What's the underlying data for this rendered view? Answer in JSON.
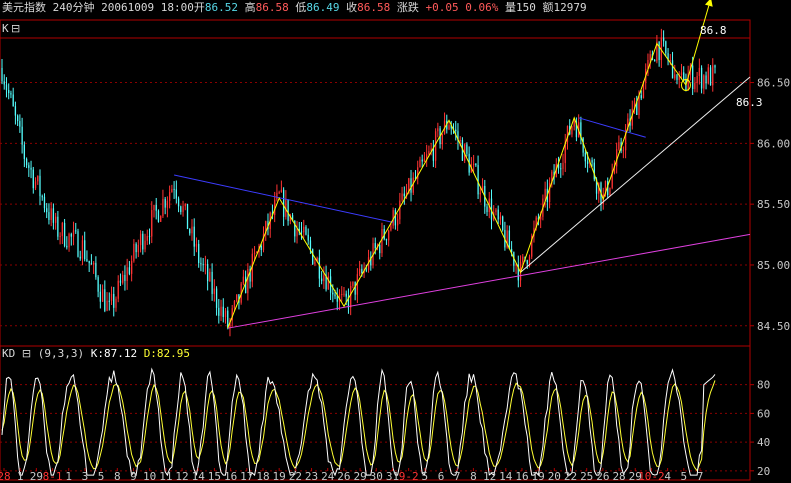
{
  "header": {
    "name": "美元指数",
    "period": "240分钟",
    "datetime": "20061009 18:00",
    "open_label": "开",
    "open": "86.52",
    "high_label": "高",
    "high": "86.58",
    "low_label": "低",
    "low": "86.49",
    "close_label": "收",
    "close": "86.58",
    "chg_label": "涨跌",
    "chg": "+0.05",
    "chg_pct": "0.06%",
    "vol_label": "量",
    "vol": "150",
    "amt_label": "额",
    "amt": "12979"
  },
  "price_panel": {
    "label": "K",
    "button": "⊟",
    "annot_top": "86.8",
    "annot_low": "86.3"
  },
  "kd_panel": {
    "label": "KD",
    "button": "⊟",
    "params": "(9,3,3)",
    "k_text": "K:87.12",
    "d_text": "D:82.95"
  },
  "colors": {
    "up": "#ff3333",
    "down": "#54fcfc",
    "frame": "#b00000",
    "grid": "#8a0000",
    "trend_blue": "#3c3cff",
    "zigzag": "#ffff00",
    "support_magenta": "#e040e0",
    "support_white": "#f0f0f0",
    "k_line": "#ffffff",
    "d_line": "#ffff33",
    "axis_text": "#c8c8c8"
  },
  "chart_data": [
    {
      "type": "candlestick",
      "title": "",
      "ylim": [
        84.35,
        86.85
      ],
      "y_ticks": [
        "86.50",
        "86.00",
        "85.50",
        "85.00",
        "84.50"
      ],
      "overlays": {
        "zigzag": [
          {
            "bar": 101,
            "price": 84.48
          },
          {
            "bar": 124,
            "price": 85.55
          },
          {
            "bar": 153,
            "price": 84.66
          },
          {
            "bar": 200,
            "price": 86.19
          },
          {
            "bar": 232,
            "price": 84.94
          },
          {
            "bar": 256,
            "price": 86.21
          },
          {
            "bar": 269,
            "price": 85.54
          },
          {
            "bar": 293,
            "price": 86.82
          },
          {
            "bar": 306,
            "price": 86.48
          },
          {
            "bar": 314,
            "price": 86.99
          }
        ],
        "resistance_lines": [
          {
            "from": {
              "bar": 77,
              "price": 85.74
            },
            "to": {
              "bar": 175,
              "price": 85.35
            }
          },
          {
            "from": {
              "bar": 258,
              "price": 86.21
            },
            "to": {
              "bar": 288,
              "price": 86.05
            }
          }
        ],
        "support_lines": [
          {
            "color": "magenta",
            "from": {
              "bar": 101,
              "price": 84.48
            },
            "to": {
              "bar": 310,
              "price": 85.17
            }
          },
          {
            "color": "white",
            "from": {
              "bar": 232,
              "price": 84.94
            },
            "to": {
              "bar": 310,
              "price": 86.16
            }
          }
        ]
      }
    },
    {
      "type": "line",
      "title": "",
      "ylim": [
        15,
        93
      ],
      "y_ticks": [
        "80",
        "60",
        "40",
        "20"
      ],
      "series": [
        {
          "name": "K",
          "values": [
            87.12
          ]
        },
        {
          "name": "D",
          "values": [
            82.95
          ]
        }
      ],
      "x_tick_labels": [
        {
          "label": "28",
          "red": true
        },
        {
          "label": "1"
        },
        {
          "label": "29"
        },
        {
          "label": "8-1",
          "red": true
        },
        {
          "label": "1"
        },
        {
          "label": "3"
        },
        {
          "label": "5"
        },
        {
          "label": "8"
        },
        {
          "label": "9"
        },
        {
          "label": "10"
        },
        {
          "label": "11"
        },
        {
          "label": "12"
        },
        {
          "label": "14"
        },
        {
          "label": "15"
        },
        {
          "label": "16"
        },
        {
          "label": "17"
        },
        {
          "label": "18"
        },
        {
          "label": "19"
        },
        {
          "label": "22"
        },
        {
          "label": "23"
        },
        {
          "label": "24"
        },
        {
          "label": "26"
        },
        {
          "label": "29"
        },
        {
          "label": "30"
        },
        {
          "label": "31"
        },
        {
          "label": "9-2",
          "red": true
        },
        {
          "label": "5"
        },
        {
          "label": "6"
        },
        {
          "label": "7"
        },
        {
          "label": "8"
        },
        {
          "label": "12"
        },
        {
          "label": "14"
        },
        {
          "label": "16"
        },
        {
          "label": "19"
        },
        {
          "label": "20"
        },
        {
          "label": "22"
        },
        {
          "label": "25"
        },
        {
          "label": "26"
        },
        {
          "label": "28"
        },
        {
          "label": "29"
        },
        {
          "label": "10-2",
          "red": true
        },
        {
          "label": "4"
        },
        {
          "label": "5"
        },
        {
          "label": "7"
        }
      ]
    }
  ]
}
